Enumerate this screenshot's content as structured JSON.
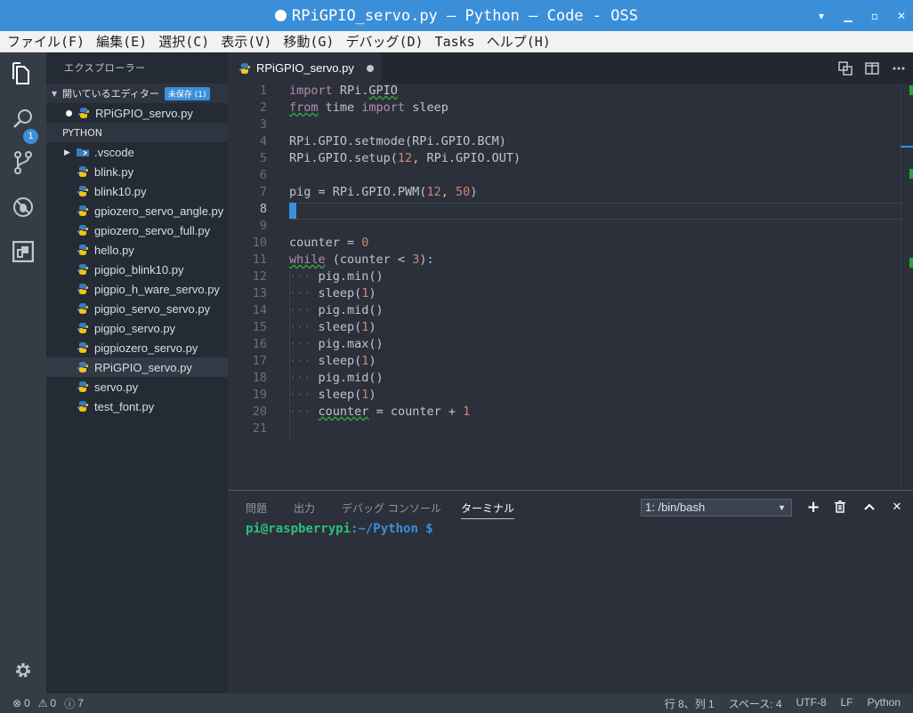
{
  "window": {
    "title": "RPiGPIO_servo.py — Python — Code - OSS"
  },
  "menu": [
    "ファイル(F)",
    "編集(E)",
    "選択(C)",
    "表示(V)",
    "移動(G)",
    "デバッグ(D)",
    "Tasks",
    "ヘルプ(H)"
  ],
  "activity": {
    "explorer_badge": "1"
  },
  "sidebar": {
    "title": "エクスプローラー",
    "open_editors": {
      "label": "開いているエディター",
      "badge": "未保存 (1)",
      "files": [
        "RPiGPIO_servo.py"
      ]
    },
    "folder": {
      "label": "PYTHON",
      "subfolder": ".vscode",
      "files": [
        "blink.py",
        "blink10.py",
        "gpiozero_servo_angle.py",
        "gpiozero_servo_full.py",
        "hello.py",
        "pigpio_blink10.py",
        "pigpio_h_ware_servo.py",
        "pigpio_servo_servo.py",
        "pigpio_servo.py",
        "pigpiozero_servo.py",
        "RPiGPIO_servo.py",
        "servo.py",
        "test_font.py"
      ],
      "active_file": "RPiGPIO_servo.py"
    }
  },
  "editor": {
    "tab_label": "RPiGPIO_servo.py",
    "line_numbers": [
      "1",
      "2",
      "3",
      "4",
      "5",
      "6",
      "7",
      "8",
      "9",
      "10",
      "11",
      "12",
      "13",
      "14",
      "15",
      "16",
      "17",
      "18",
      "19",
      "20",
      "21"
    ]
  },
  "panel": {
    "tabs": [
      "問題",
      "出力",
      "デバッグ コンソール",
      "ターミナル"
    ],
    "active_tab": "ターミナル",
    "terminal_select": "1: /bin/bash",
    "prompt_user": "pi@raspberrypi",
    "prompt_path": ":~/Python $"
  },
  "status": {
    "errors": "0",
    "warnings": "0",
    "info": "7",
    "position": "行 8、列 1",
    "spaces": "スペース: 4",
    "encoding": "UTF-8",
    "eol": "LF",
    "language": "Python"
  },
  "colors": {
    "accent": "#3b8fd9",
    "editor_bg": "#2b303b",
    "sidebar_bg": "#252b35",
    "activity_bg": "#343d46",
    "prompt_user": "#2bc07a",
    "prompt_path": "#3b8fd9"
  }
}
